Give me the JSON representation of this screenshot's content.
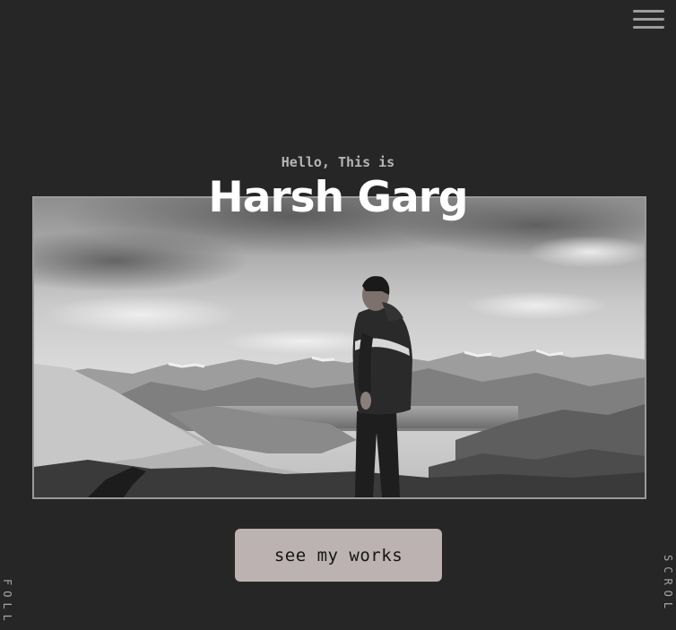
{
  "header": {
    "menu_icon": "hamburger-menu-icon"
  },
  "hero": {
    "greeting": "Hello, This is",
    "name": "Harsh Garg",
    "photo_icon": "profile-photo"
  },
  "cta": {
    "label": "see my works"
  },
  "side": {
    "left_label": "FOLL",
    "right_label": "SCROL"
  },
  "colors": {
    "background": "#262626",
    "button_bg": "#bcb2b2",
    "button_text": "#141414",
    "greeting": "#b9b4b4",
    "name": "#ffffff"
  }
}
